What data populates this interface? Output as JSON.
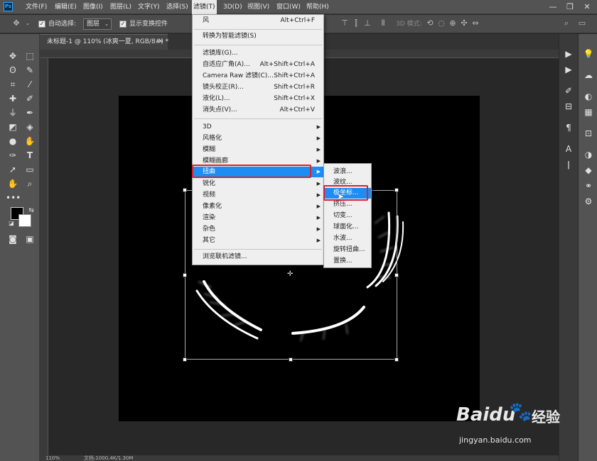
{
  "app": {
    "logo": "Ps"
  },
  "menubar": {
    "items": [
      "文件(F)",
      "编辑(E)",
      "图像(I)",
      "图层(L)",
      "文字(Y)",
      "选择(S)",
      "滤镜(T)",
      "3D(D)",
      "视图(V)",
      "窗口(W)",
      "帮助(H)"
    ],
    "minimize": "—",
    "maximize": "❐",
    "close": "✕"
  },
  "options": {
    "auto_select_label": "自动选择:",
    "auto_select_value": "图层",
    "show_transform_label": "显示变换控件",
    "mode_3d_label": "3D 模式:"
  },
  "document": {
    "tab_title": "未标题-1 @ 110% (冰爽一夏, RGB/8#) *",
    "zoom": "110%",
    "doc_info": "文档:1000.4K/1.30M"
  },
  "filter_menu": {
    "items": [
      {
        "label": "风",
        "shortcut": "Alt+Ctrl+F"
      },
      {
        "label": "转换为智能滤镜(S)",
        "shortcut": ""
      },
      {
        "label": "滤镜库(G)...",
        "shortcut": ""
      },
      {
        "label": "自适应广角(A)...",
        "shortcut": "Alt+Shift+Ctrl+A"
      },
      {
        "label": "Camera Raw 滤镜(C)...",
        "shortcut": "Shift+Ctrl+A"
      },
      {
        "label": "镜头校正(R)...",
        "shortcut": "Shift+Ctrl+R"
      },
      {
        "label": "液化(L)...",
        "shortcut": "Shift+Ctrl+X"
      },
      {
        "label": "消失点(V)...",
        "shortcut": "Alt+Ctrl+V"
      },
      {
        "label": "3D",
        "shortcut": ""
      },
      {
        "label": "风格化",
        "shortcut": ""
      },
      {
        "label": "模糊",
        "shortcut": ""
      },
      {
        "label": "模糊画廊",
        "shortcut": ""
      },
      {
        "label": "扭曲",
        "shortcut": ""
      },
      {
        "label": "锐化",
        "shortcut": ""
      },
      {
        "label": "视频",
        "shortcut": ""
      },
      {
        "label": "像素化",
        "shortcut": ""
      },
      {
        "label": "渲染",
        "shortcut": ""
      },
      {
        "label": "杂色",
        "shortcut": ""
      },
      {
        "label": "其它",
        "shortcut": ""
      },
      {
        "label": "浏览联机滤镜...",
        "shortcut": ""
      }
    ]
  },
  "distort_submenu": {
    "items": [
      "波浪...",
      "波纹...",
      "极坐标...",
      "挤压...",
      "切变...",
      "球面化...",
      "水波...",
      "旋转扭曲...",
      "置换..."
    ]
  },
  "watermark": {
    "brand": "Baidu",
    "cn": "经验",
    "url": "jingyan.baidu.com"
  },
  "colors": {
    "highlight": "#1c8df2",
    "annotation": "#e0202a",
    "foreground": "#000000",
    "background": "#ffffff"
  }
}
